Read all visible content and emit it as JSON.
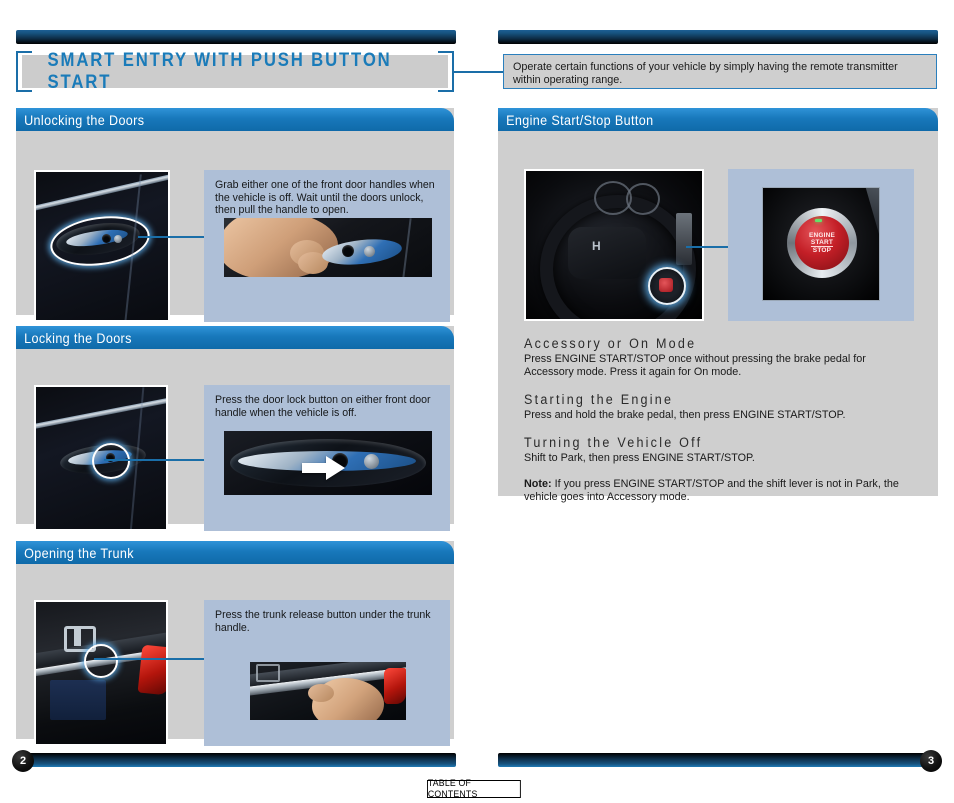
{
  "document": {
    "title": "SMART ENTRY WITH PUSH BUTTON START",
    "intro": "Operate certain functions of your vehicle by simply having the remote transmitter within operating range."
  },
  "footer": {
    "left_page": "2",
    "right_page": "3",
    "table_of_contents": "TABLE OF CONTENTS"
  },
  "left_column": {
    "sections": [
      {
        "heading": "Unlocking the Doors",
        "instruction": "Grab either one of the front door handles when the vehicle is off. Wait until the doors unlock, then pull the handle to open.",
        "main_photo": "car-door-handle-highlighted",
        "inset_photo": "hand-grabbing-door-handle"
      },
      {
        "heading": "Locking the Doors",
        "instruction": "Press the door lock button on either front door handle when the vehicle is off.",
        "main_photo": "car-door-handle-lock-button",
        "inset_photo": "door-handle-lock-button-closeup-arrow"
      },
      {
        "heading": "Opening the Trunk",
        "instruction": "Press the trunk release button under the trunk handle.",
        "main_photo": "trunk-lid-release-highlighted",
        "inset_photo": "hand-pressing-trunk-release"
      }
    ]
  },
  "right_column": {
    "section": {
      "heading": "Engine Start/Stop Button",
      "main_photo": "steering-wheel-with-start-button",
      "inset_photo": "engine-start-stop-button-closeup",
      "button_label": {
        "line1": "ENGINE",
        "line2": "START",
        "line3": "STOP"
      },
      "topics": [
        {
          "subheading": "Accessory or On Mode",
          "text": "Press ENGINE START/STOP once without pressing the brake pedal for Accessory mode. Press it again for On mode."
        },
        {
          "subheading": "Starting the Engine",
          "text": "Press and hold the brake pedal,  then press ENGINE START/STOP."
        },
        {
          "subheading": "Turning the Vehicle Off",
          "text": "Shift to Park, then press ENGINE START/STOP."
        }
      ],
      "note_label": "Note:",
      "note_text": " If you press ENGINE START/STOP and the shift lever is not in Park, the vehicle goes into Accessory mode."
    }
  },
  "theme": {
    "accent_blue": "#1878bb",
    "header_blue": "#2f93d8",
    "title_blue": "#1a7bb9",
    "panel_gray": "#cfcfcf",
    "textbox_blue": "#aebfd7"
  }
}
